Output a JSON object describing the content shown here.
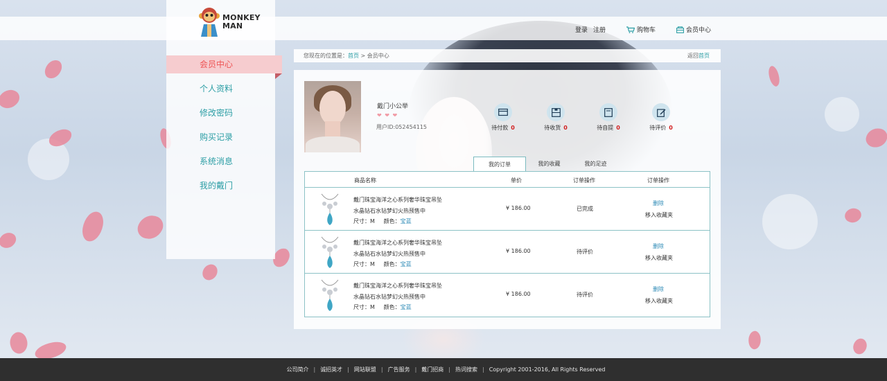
{
  "logo": {
    "line1": "MONKEY",
    "line2": "MAN"
  },
  "topnav": {
    "login": "登录",
    "register": "注册",
    "cart": "购物车",
    "member": "会员中心"
  },
  "sidebar": {
    "items": [
      {
        "label": "会员中心"
      },
      {
        "label": "个人资料"
      },
      {
        "label": "修改密码"
      },
      {
        "label": "购买记录"
      },
      {
        "label": "系统消息"
      },
      {
        "label": "我的戴门"
      }
    ]
  },
  "breadcrumb": {
    "prefix": "您现在的位置是：",
    "home": "首页",
    "sep": " > ",
    "current": "会员中心",
    "back_prefix": "返回",
    "back_link": "首页"
  },
  "profile": {
    "name": "戴门小公举",
    "hearts": "❤ ❤ ❤",
    "uid": "用户ID:052454115"
  },
  "status": [
    {
      "label": "待付款",
      "count": "0",
      "icon": "wallet-icon"
    },
    {
      "label": "待收货",
      "count": "0",
      "icon": "package-icon"
    },
    {
      "label": "待自提",
      "count": "0",
      "icon": "box-icon"
    },
    {
      "label": "待评价",
      "count": "0",
      "icon": "edit-icon"
    }
  ],
  "tabs": [
    {
      "label": "我的订单"
    },
    {
      "label": "我的收藏"
    },
    {
      "label": "我的足迹"
    }
  ],
  "table": {
    "headers": [
      "商品名称",
      "单价",
      "订单操作",
      "订单操作"
    ],
    "rows": [
      {
        "title1": "戴门珠宝海洋之心系列奢华珠宝吊坠",
        "title2": "水晶钻石水钻梦幻火热预售中",
        "size_label": "尺寸：",
        "size": "M",
        "color_label": "颜色：",
        "color": "宝蓝",
        "price": "¥ 186.00",
        "status": "已完成",
        "delete": "删除",
        "fav": "移入收藏夹"
      },
      {
        "title1": "戴门珠宝海洋之心系列奢华珠宝吊坠",
        "title2": "水晶钻石水钻梦幻火热预售中",
        "size_label": "尺寸：",
        "size": "M",
        "color_label": "颜色：",
        "color": "宝蓝",
        "price": "¥ 186.00",
        "status": "待评价",
        "delete": "删除",
        "fav": "移入收藏夹"
      },
      {
        "title1": "戴门珠宝海洋之心系列奢华珠宝吊坠",
        "title2": "水晶钻石水钻梦幻火热预售中",
        "size_label": "尺寸：",
        "size": "M",
        "color_label": "颜色：",
        "color": "宝蓝",
        "price": "¥ 186.00",
        "status": "待评价",
        "delete": "删除",
        "fav": "移入收藏夹"
      }
    ]
  },
  "footer": {
    "links": [
      "公司简介",
      "诚招英才",
      "网站联盟",
      "广告服务",
      "戴门招商",
      "热词搜索"
    ],
    "copyright": "Copyright   2001-2016, All Rights Reserved"
  },
  "colors": {
    "accent": "#2c9ea5",
    "active_bg": "#f6cccf",
    "count": "#d21d1d",
    "footer_bg": "#2f2f2f"
  }
}
